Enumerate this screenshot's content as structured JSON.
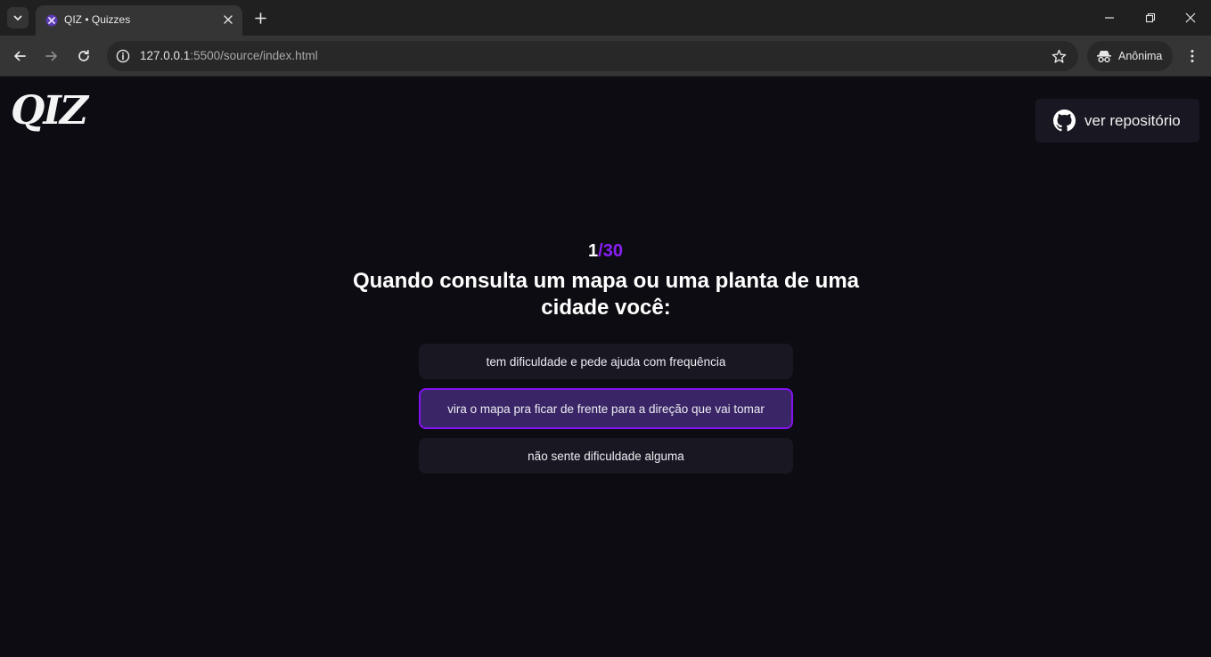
{
  "browser": {
    "tab_title": "QIZ • Quizzes",
    "url_host": "127.0.0.1",
    "url_rest": ":5500/source/index.html",
    "profile_label": "Anônima"
  },
  "page": {
    "logo_text": "QIZ",
    "repo_button_label": "ver repositório",
    "progress": {
      "current": "1",
      "total_text": "/30"
    },
    "question": "Quando consulta um mapa ou uma planta de uma cidade você:",
    "options": [
      {
        "label": "tem dificuldade e pede ajuda com frequência",
        "selected": false
      },
      {
        "label": "vira o mapa pra ficar de frente para a direção que vai tomar",
        "selected": true
      },
      {
        "label": "não sente dificuldade alguma",
        "selected": false
      }
    ]
  },
  "colors": {
    "accent": "#8313f0",
    "background": "#0d0c13",
    "card": "#191822",
    "selected_fill": "#3a2667"
  },
  "icons": {
    "tab_search": "chevron-down-icon",
    "favicon": "qiz-favicon-icon",
    "tab_close": "close-icon",
    "new_tab": "plus-icon",
    "back": "arrow-left-icon",
    "forward": "arrow-right-icon",
    "reload": "reload-icon",
    "site_info": "info-icon",
    "bookmark": "star-icon",
    "incognito": "incognito-icon",
    "menu": "kebab-menu-icon",
    "repo": "github-icon"
  }
}
